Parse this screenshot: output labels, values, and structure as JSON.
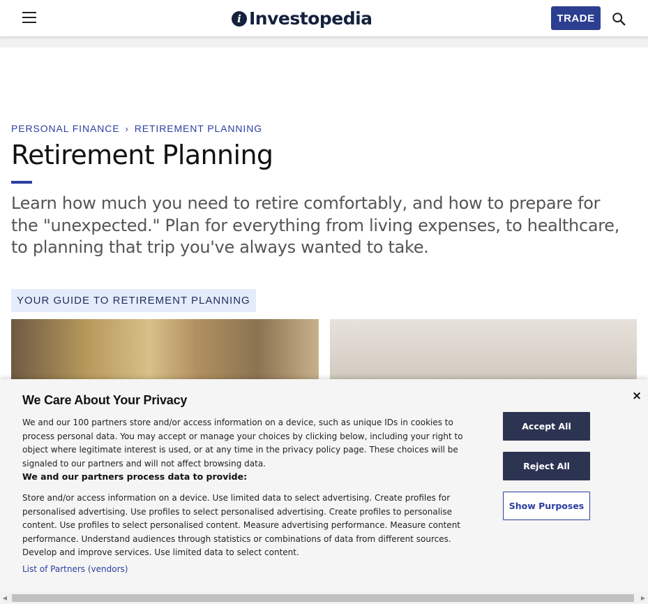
{
  "header": {
    "logo_text": "Investopedia",
    "trade_label": "TRADE"
  },
  "breadcrumb": {
    "items": [
      "PERSONAL FINANCE",
      "RETIREMENT PLANNING"
    ],
    "separator": "›"
  },
  "page": {
    "title": "Retirement Planning",
    "intro": "Learn how much you need to retire comfortably, and how to prepare for the \"unexpected.\" Plan for everything from living expenses, to healthcare, to planning that trip you've always wanted to take.",
    "guide_label": "YOUR GUIDE TO RETIREMENT PLANNING"
  },
  "consent": {
    "title": "We Care About Your Privacy",
    "body": "We and our 100 partners store and/or access information on a device, such as unique IDs in cookies to process personal data. You may accept or manage your choices by clicking below, including your right to object where legitimate interest is used, or at any time in the privacy policy page. These choices will be signaled to our partners and will not affect browsing data.",
    "subheading": "We and our partners process data to provide:",
    "purposes": "Store and/or access information on a device. Use limited data to select advertising. Create profiles for personalised advertising. Use profiles to select personalised advertising. Create profiles to personalise content. Use profiles to select personalised content. Measure advertising performance. Measure content performance. Understand audiences through statistics or combinations of data from different sources. Develop and improve services. Use limited data to select content.",
    "partners_link": "List of Partners (vendors)",
    "accept_label": "Accept All",
    "reject_label": "Reject All",
    "purposes_label": "Show Purposes",
    "close_glyph": "×"
  },
  "colors": {
    "accent": "#2c3e9f",
    "trade_bg": "#2c3e8f",
    "button_dark": "#2d3452",
    "tag_bg": "#e4ecfb"
  }
}
